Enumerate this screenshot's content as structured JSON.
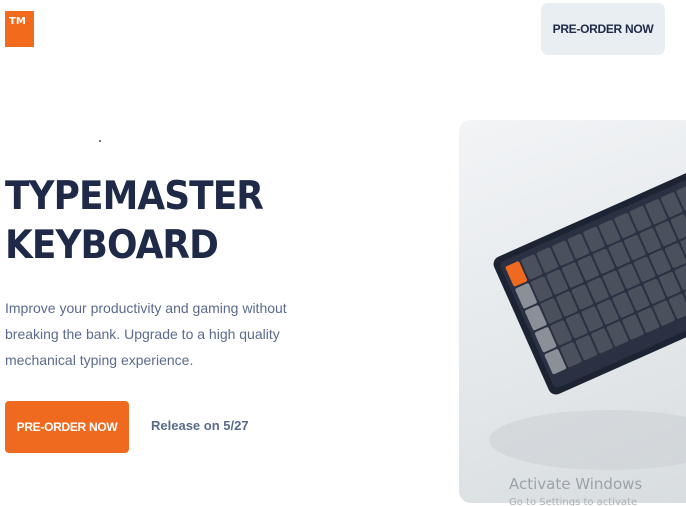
{
  "header": {
    "logo_text": "TM",
    "preorder_label": "PRE-ORDER NOW"
  },
  "hero": {
    "title_line1": "TYPEMASTER",
    "title_line2": "KEYBOARD",
    "description": "Improve your productivity and gaming without breaking the bank. Upgrade to a high quality mechanical typing experience.",
    "cta_label": "PRE-ORDER NOW",
    "release_text": "Release on 5/27",
    "image_icon": "keyboard-image"
  },
  "watermark": {
    "title": "Activate Windows",
    "subtitle": "Go to Settings to activate Windows."
  },
  "colors": {
    "accent": "#ef6a1e",
    "navy": "#1e2a47",
    "muted": "#5b6b8c",
    "nav_bg": "#e9eef3"
  }
}
